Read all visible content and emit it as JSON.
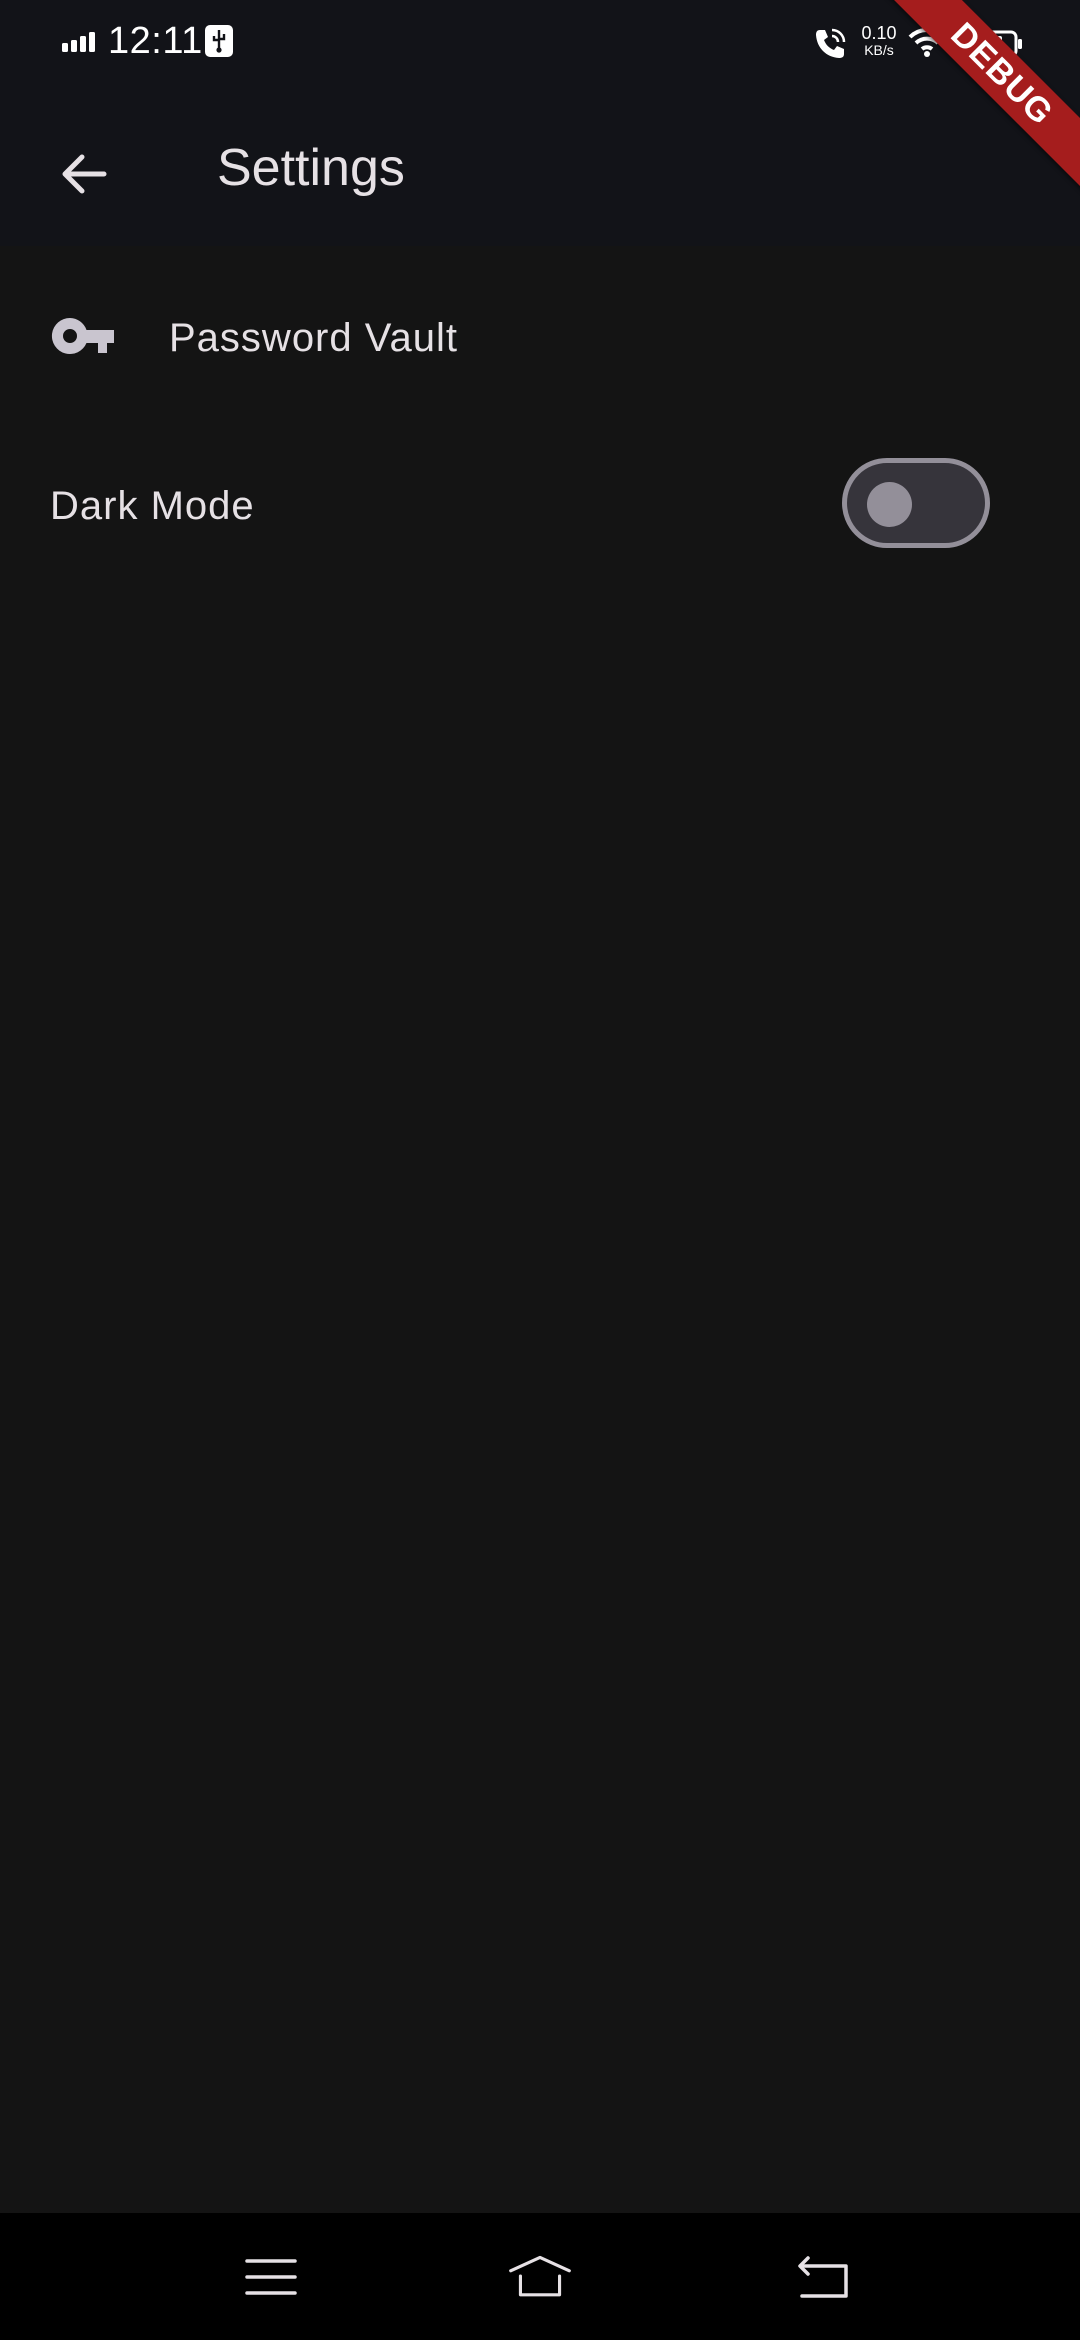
{
  "status_bar": {
    "time": "12:11",
    "net_speed_value": "0.10",
    "net_speed_unit": "KB/s",
    "icons": [
      "signal-icon",
      "usb-debug-icon",
      "wifi-call-icon",
      "wifi-icon",
      "battery-icon"
    ]
  },
  "debug_banner": {
    "label": "DEBUG"
  },
  "app_bar": {
    "title": "Settings",
    "back_icon": "arrow-back-icon"
  },
  "settings": {
    "password_vault": {
      "label": "Password Vault",
      "icon": "key-icon"
    },
    "dark_mode": {
      "label": "Dark Mode",
      "enabled": false
    }
  },
  "nav_bar": {
    "icons": [
      "menu-icon",
      "home-icon",
      "back-icon"
    ]
  },
  "colors": {
    "background": "#141414",
    "top_background": "#121318",
    "text": "#e6e1e5",
    "toggle_outline": "#938f99",
    "toggle_track": "#36343b",
    "debug_banner": "#a51d1d"
  }
}
